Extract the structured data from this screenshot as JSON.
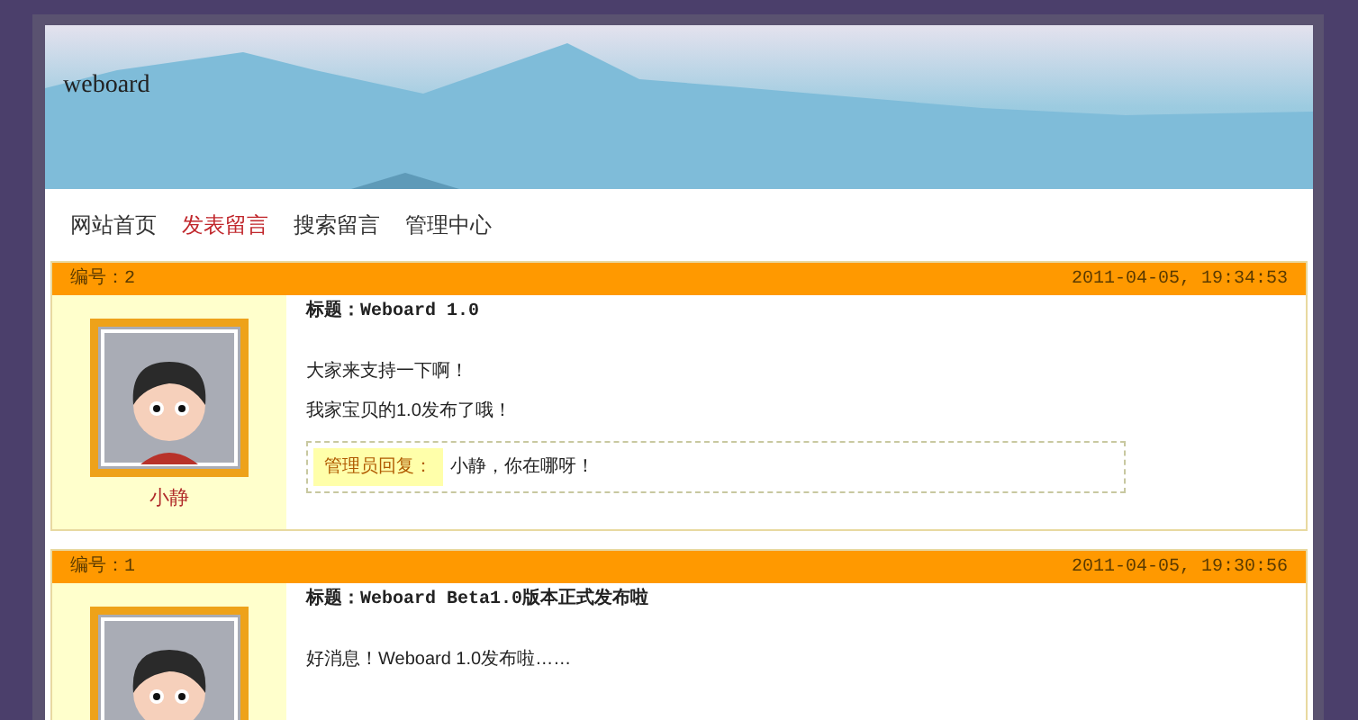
{
  "site": {
    "title": "weboard"
  },
  "nav": [
    {
      "label": "网站首页",
      "selected": false
    },
    {
      "label": "发表留言",
      "selected": true
    },
    {
      "label": "搜索留言",
      "selected": false
    },
    {
      "label": "管理中心",
      "selected": false
    }
  ],
  "posts": [
    {
      "number": "编号：2",
      "time": "2011-04-05, 19:34:53",
      "author": "小静",
      "title": "标题：Weboard 1.0",
      "lines": [
        "大家来支持一下啊！",
        "我家宝贝的1.0发布了哦！"
      ],
      "reply": {
        "label": "管理员回复：",
        "text": "小静，你在哪呀！"
      }
    },
    {
      "number": "编号：1",
      "time": "2011-04-05, 19:30:56",
      "title": "标题：Weboard Beta1.0版本正式发布啦",
      "lines": [
        "好消息！Weboard 1.0发布啦……"
      ]
    }
  ]
}
